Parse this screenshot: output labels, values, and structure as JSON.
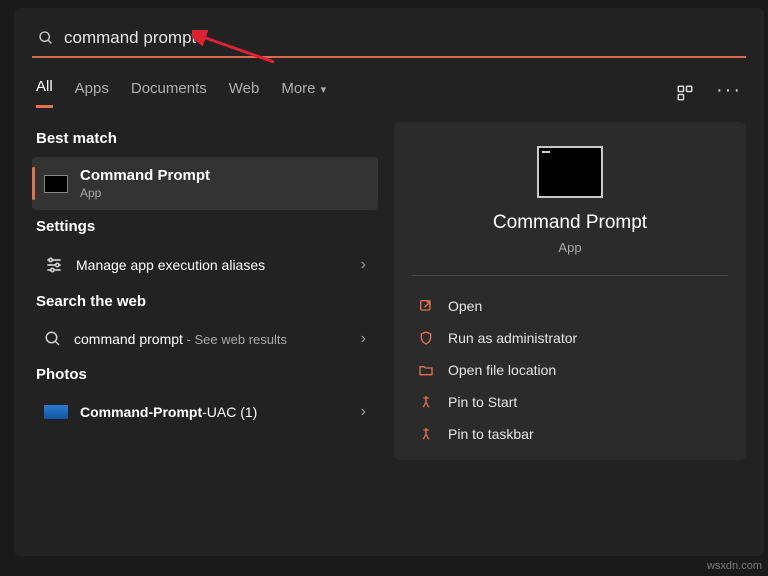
{
  "search": {
    "value": "command prompt"
  },
  "tabs": {
    "items": [
      "All",
      "Apps",
      "Documents",
      "Web",
      "More"
    ],
    "active": 0
  },
  "sections": {
    "best_match": "Best match",
    "settings": "Settings",
    "search_web": "Search the web",
    "photos": "Photos"
  },
  "best_match": {
    "title": "Command Prompt",
    "subtitle": "App"
  },
  "settings_item": "Manage app execution aliases",
  "web_item": {
    "query": "command prompt",
    "suffix": " - See web results"
  },
  "photo_item": {
    "prefix": "Command-Prompt",
    "suffix": "-UAC (1)"
  },
  "preview": {
    "title": "Command Prompt",
    "subtitle": "App"
  },
  "actions": {
    "open": "Open",
    "admin": "Run as administrator",
    "file_loc": "Open file location",
    "pin_start": "Pin to Start",
    "pin_taskbar": "Pin to taskbar"
  },
  "watermark": "wsxdn.com"
}
